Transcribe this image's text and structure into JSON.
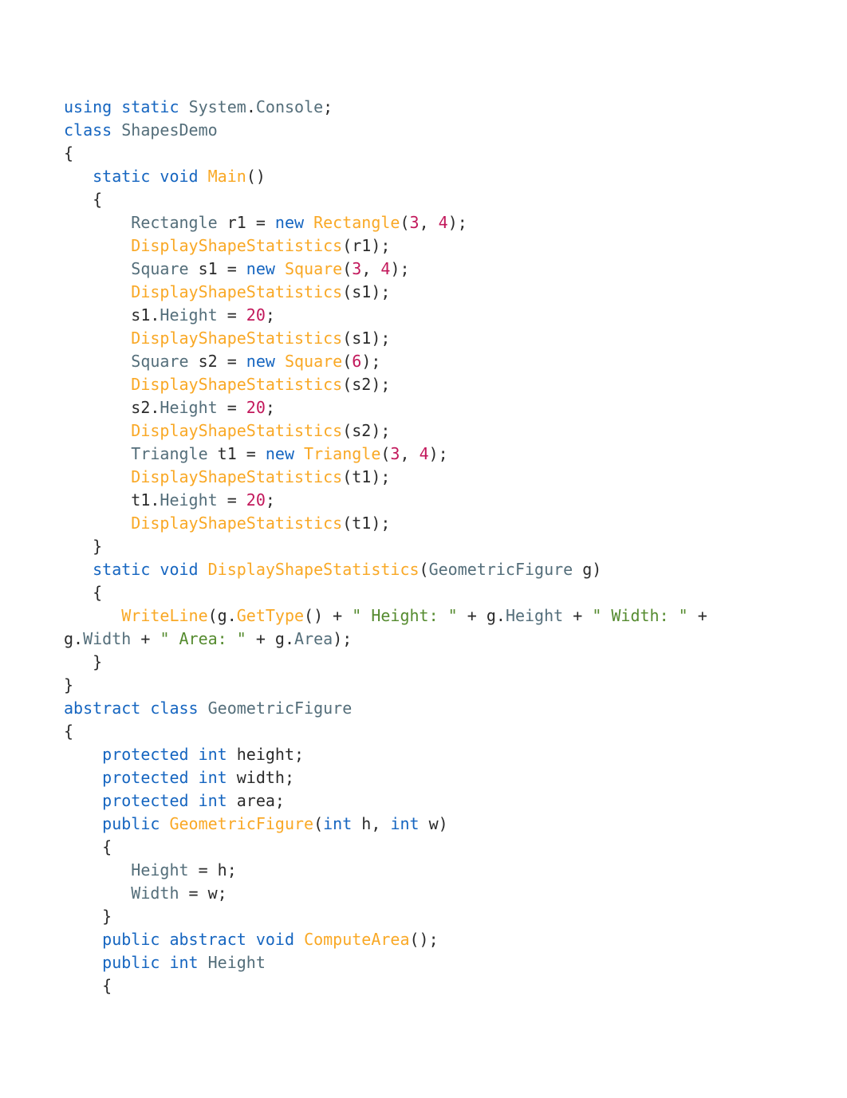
{
  "code": {
    "tokens": [
      {
        "c": "kw",
        "t": "using"
      },
      {
        "c": "plain",
        "t": " "
      },
      {
        "c": "kw",
        "t": "static"
      },
      {
        "c": "plain",
        "t": " "
      },
      {
        "c": "type",
        "t": "System"
      },
      {
        "c": "plain",
        "t": "."
      },
      {
        "c": "type",
        "t": "Console"
      },
      {
        "c": "plain",
        "t": ";\n"
      },
      {
        "c": "kw",
        "t": "class"
      },
      {
        "c": "plain",
        "t": " "
      },
      {
        "c": "type",
        "t": "ShapesDemo"
      },
      {
        "c": "plain",
        "t": "\n{\n   "
      },
      {
        "c": "kw",
        "t": "static"
      },
      {
        "c": "plain",
        "t": " "
      },
      {
        "c": "kw",
        "t": "void"
      },
      {
        "c": "plain",
        "t": " "
      },
      {
        "c": "func",
        "t": "Main"
      },
      {
        "c": "plain",
        "t": "()\n   {\n       "
      },
      {
        "c": "type",
        "t": "Rectangle"
      },
      {
        "c": "plain",
        "t": " r1 = "
      },
      {
        "c": "kw",
        "t": "new"
      },
      {
        "c": "plain",
        "t": " "
      },
      {
        "c": "ctor",
        "t": "Rectangle"
      },
      {
        "c": "plain",
        "t": "("
      },
      {
        "c": "num",
        "t": "3"
      },
      {
        "c": "plain",
        "t": ", "
      },
      {
        "c": "num",
        "t": "4"
      },
      {
        "c": "plain",
        "t": ");\n       "
      },
      {
        "c": "func",
        "t": "DisplayShapeStatistics"
      },
      {
        "c": "plain",
        "t": "(r1);\n       "
      },
      {
        "c": "type",
        "t": "Square"
      },
      {
        "c": "plain",
        "t": " s1 = "
      },
      {
        "c": "kw",
        "t": "new"
      },
      {
        "c": "plain",
        "t": " "
      },
      {
        "c": "ctor",
        "t": "Square"
      },
      {
        "c": "plain",
        "t": "("
      },
      {
        "c": "num",
        "t": "3"
      },
      {
        "c": "plain",
        "t": ", "
      },
      {
        "c": "num",
        "t": "4"
      },
      {
        "c": "plain",
        "t": ");\n       "
      },
      {
        "c": "func",
        "t": "DisplayShapeStatistics"
      },
      {
        "c": "plain",
        "t": "(s1);\n       s1."
      },
      {
        "c": "prop",
        "t": "Height"
      },
      {
        "c": "plain",
        "t": " = "
      },
      {
        "c": "num",
        "t": "20"
      },
      {
        "c": "plain",
        "t": ";\n       "
      },
      {
        "c": "func",
        "t": "DisplayShapeStatistics"
      },
      {
        "c": "plain",
        "t": "(s1);\n       "
      },
      {
        "c": "type",
        "t": "Square"
      },
      {
        "c": "plain",
        "t": " s2 = "
      },
      {
        "c": "kw",
        "t": "new"
      },
      {
        "c": "plain",
        "t": " "
      },
      {
        "c": "ctor",
        "t": "Square"
      },
      {
        "c": "plain",
        "t": "("
      },
      {
        "c": "num",
        "t": "6"
      },
      {
        "c": "plain",
        "t": ");\n       "
      },
      {
        "c": "func",
        "t": "DisplayShapeStatistics"
      },
      {
        "c": "plain",
        "t": "(s2);\n       s2."
      },
      {
        "c": "prop",
        "t": "Height"
      },
      {
        "c": "plain",
        "t": " = "
      },
      {
        "c": "num",
        "t": "20"
      },
      {
        "c": "plain",
        "t": ";\n       "
      },
      {
        "c": "func",
        "t": "DisplayShapeStatistics"
      },
      {
        "c": "plain",
        "t": "(s2);\n       "
      },
      {
        "c": "type",
        "t": "Triangle"
      },
      {
        "c": "plain",
        "t": " t1 = "
      },
      {
        "c": "kw",
        "t": "new"
      },
      {
        "c": "plain",
        "t": " "
      },
      {
        "c": "ctor",
        "t": "Triangle"
      },
      {
        "c": "plain",
        "t": "("
      },
      {
        "c": "num",
        "t": "3"
      },
      {
        "c": "plain",
        "t": ", "
      },
      {
        "c": "num",
        "t": "4"
      },
      {
        "c": "plain",
        "t": ");\n       "
      },
      {
        "c": "func",
        "t": "DisplayShapeStatistics"
      },
      {
        "c": "plain",
        "t": "(t1);\n       t1."
      },
      {
        "c": "prop",
        "t": "Height"
      },
      {
        "c": "plain",
        "t": " = "
      },
      {
        "c": "num",
        "t": "20"
      },
      {
        "c": "plain",
        "t": ";\n       "
      },
      {
        "c": "func",
        "t": "DisplayShapeStatistics"
      },
      {
        "c": "plain",
        "t": "(t1);\n   }\n   "
      },
      {
        "c": "kw",
        "t": "static"
      },
      {
        "c": "plain",
        "t": " "
      },
      {
        "c": "kw",
        "t": "void"
      },
      {
        "c": "plain",
        "t": " "
      },
      {
        "c": "func",
        "t": "DisplayShapeStatistics"
      },
      {
        "c": "plain",
        "t": "("
      },
      {
        "c": "type",
        "t": "GeometricFigure"
      },
      {
        "c": "plain",
        "t": " g)\n   {\n      "
      },
      {
        "c": "func",
        "t": "WriteLine"
      },
      {
        "c": "plain",
        "t": "(g."
      },
      {
        "c": "func",
        "t": "GetType"
      },
      {
        "c": "plain",
        "t": "() + "
      },
      {
        "c": "str",
        "t": "\" Height: \""
      },
      {
        "c": "plain",
        "t": " + g."
      },
      {
        "c": "prop",
        "t": "Height"
      },
      {
        "c": "plain",
        "t": " + "
      },
      {
        "c": "str",
        "t": "\" Width: \""
      },
      {
        "c": "plain",
        "t": " + g."
      },
      {
        "c": "prop",
        "t": "Width"
      },
      {
        "c": "plain",
        "t": " + "
      },
      {
        "c": "str",
        "t": "\" Area: \""
      },
      {
        "c": "plain",
        "t": " + g."
      },
      {
        "c": "prop",
        "t": "Area"
      },
      {
        "c": "plain",
        "t": ");\n   }\n}\n"
      },
      {
        "c": "kw",
        "t": "abstract"
      },
      {
        "c": "plain",
        "t": " "
      },
      {
        "c": "kw",
        "t": "class"
      },
      {
        "c": "plain",
        "t": " "
      },
      {
        "c": "type",
        "t": "GeometricFigure"
      },
      {
        "c": "plain",
        "t": "\n{\n    "
      },
      {
        "c": "kw",
        "t": "protected"
      },
      {
        "c": "plain",
        "t": " "
      },
      {
        "c": "kw",
        "t": "int"
      },
      {
        "c": "plain",
        "t": " height;\n    "
      },
      {
        "c": "kw",
        "t": "protected"
      },
      {
        "c": "plain",
        "t": " "
      },
      {
        "c": "kw",
        "t": "int"
      },
      {
        "c": "plain",
        "t": " width;\n    "
      },
      {
        "c": "kw",
        "t": "protected"
      },
      {
        "c": "plain",
        "t": " "
      },
      {
        "c": "kw",
        "t": "int"
      },
      {
        "c": "plain",
        "t": " area;\n    "
      },
      {
        "c": "kw",
        "t": "public"
      },
      {
        "c": "plain",
        "t": " "
      },
      {
        "c": "func",
        "t": "GeometricFigure"
      },
      {
        "c": "plain",
        "t": "("
      },
      {
        "c": "kw",
        "t": "int"
      },
      {
        "c": "plain",
        "t": " h, "
      },
      {
        "c": "kw",
        "t": "int"
      },
      {
        "c": "plain",
        "t": " w)\n    {\n       "
      },
      {
        "c": "prop",
        "t": "Height"
      },
      {
        "c": "plain",
        "t": " = h;\n       "
      },
      {
        "c": "prop",
        "t": "Width"
      },
      {
        "c": "plain",
        "t": " = w;\n    }\n    "
      },
      {
        "c": "kw",
        "t": "public"
      },
      {
        "c": "plain",
        "t": " "
      },
      {
        "c": "kw",
        "t": "abstract"
      },
      {
        "c": "plain",
        "t": " "
      },
      {
        "c": "kw",
        "t": "void"
      },
      {
        "c": "plain",
        "t": " "
      },
      {
        "c": "func",
        "t": "ComputeArea"
      },
      {
        "c": "plain",
        "t": "();\n    "
      },
      {
        "c": "kw",
        "t": "public"
      },
      {
        "c": "plain",
        "t": " "
      },
      {
        "c": "kw",
        "t": "int"
      },
      {
        "c": "plain",
        "t": " "
      },
      {
        "c": "prop",
        "t": "Height"
      },
      {
        "c": "plain",
        "t": "\n    {"
      }
    ]
  }
}
